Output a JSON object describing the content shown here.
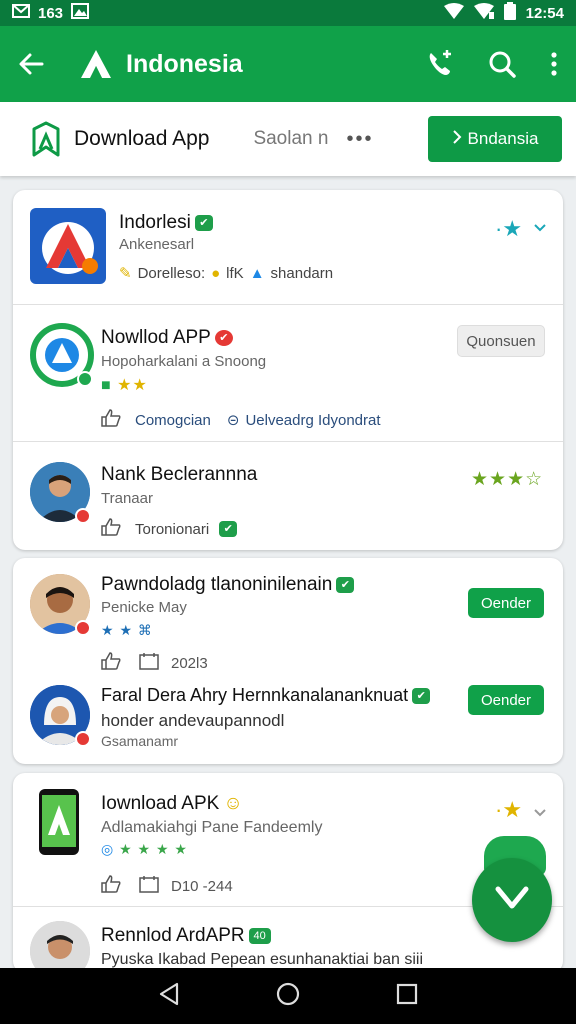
{
  "status_bar": {
    "left_text": "163",
    "time": "12:54"
  },
  "app_bar": {
    "title": "Indonesia"
  },
  "sub_bar": {
    "title": "Download App",
    "search_text": "Saolan n",
    "more": "•••",
    "button_label": "Bndansia"
  },
  "card1": {
    "row1": {
      "name": "Indorlesi",
      "subtitle": "Ankenesarl",
      "meta_a": "Dorelleso:",
      "meta_b": "lfK",
      "meta_c": "shandarn"
    },
    "row2": {
      "name": "Nowllod APP",
      "subtitle": "Hopoharkalani a Snoong",
      "stars": "★★",
      "button_label": "Quonsuen",
      "meta_a": "Comogcian",
      "meta_b": "Uelveadrg Idyondrat"
    },
    "row3": {
      "name": "Nank Beclerannna",
      "subtitle": "Tranaar",
      "stars": "★★★☆",
      "meta_a": "Toronionari"
    }
  },
  "card2": {
    "row1": {
      "name": "Pawndoladg tlanoninilenain",
      "subtitle": "Penicke May",
      "stars": "★ ★ ⌘",
      "button_label": "Oender",
      "meta_a": "202l3"
    },
    "row2": {
      "name": "Faral Dera Ahry Hernnkanalananknuat",
      "subtitle": "honder andevaupannodl",
      "subtitle2": "Gsamanamr",
      "button_label": "Oender"
    }
  },
  "card3": {
    "row1": {
      "name": "Iownload APK",
      "subtitle": "Adlamakiahgi Pane Fandeemly",
      "stars": "★ ★ ★ ★",
      "meta_a": "D10 -244"
    },
    "row2": {
      "name": "Rennlod ArdAPR",
      "subtitle": "Pyuska Ikabad Pepean esunhanaktiai ban siii"
    }
  },
  "colors": {
    "status": "#0a7a3c",
    "appbar": "#10a149",
    "accent": "#0e9a46",
    "star": "#e0b400",
    "star_green": "#3aa64a",
    "star_blue": "#1e88e5"
  }
}
